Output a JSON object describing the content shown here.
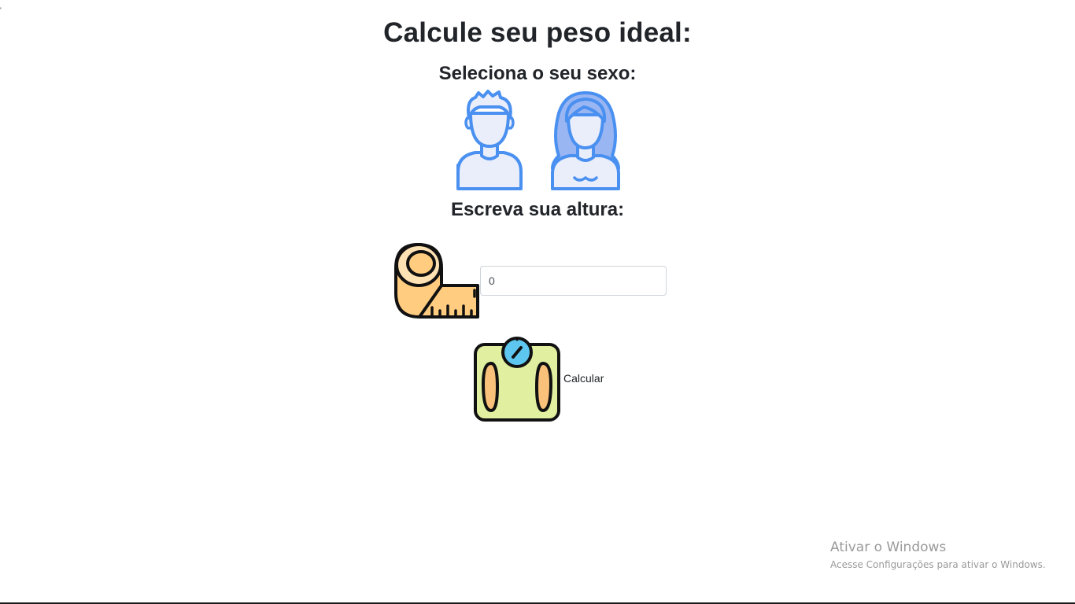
{
  "page": {
    "title": "Calcule seu peso ideal:",
    "stray_mark": "'"
  },
  "sex_section": {
    "label": "Seleciona o seu sexo:",
    "options": [
      {
        "id": "male",
        "icon": "male-avatar-icon"
      },
      {
        "id": "female",
        "icon": "female-avatar-icon"
      }
    ]
  },
  "height_section": {
    "label": "Escreva sua altura:",
    "icon": "measuring-tape-icon",
    "input_value": "0"
  },
  "calculate": {
    "icon": "bathroom-scale-icon",
    "label": "Calcular"
  },
  "watermark": {
    "title": "Ativar o Windows",
    "subtitle": "Acesse Configurações para ativar o Windows."
  },
  "colors": {
    "avatar_stroke": "#4a90f0",
    "avatar_fill": "#eaeefb",
    "female_hair": "#9ab6f2",
    "tape_fill": "#ffcc80",
    "tape_light": "#ffe2b3",
    "scale_fill": "#e1efa0",
    "scale_feet": "#f9c17a",
    "dial_fill": "#5ec7ef"
  }
}
